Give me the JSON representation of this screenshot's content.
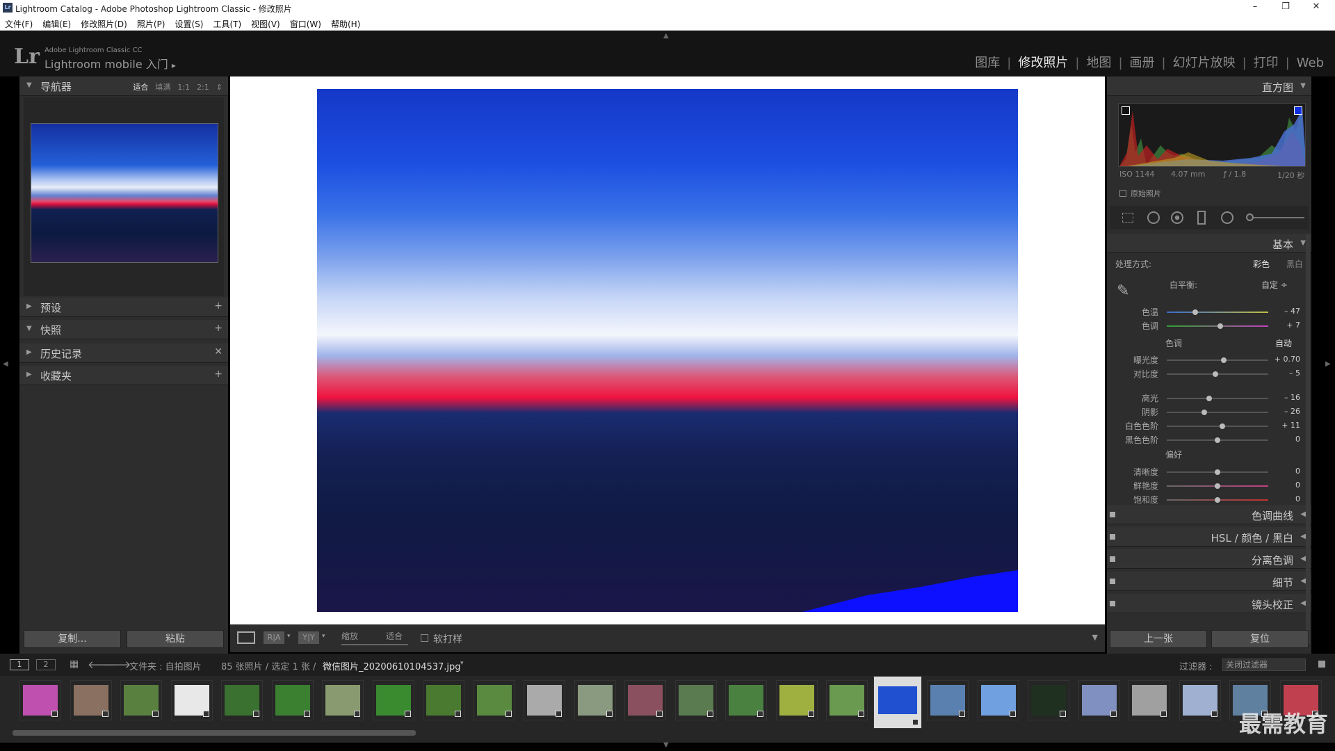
{
  "window": {
    "title": "Lightroom Catalog - Adobe Photoshop Lightroom Classic - 修改照片",
    "app_icon": "Lr",
    "minimize": "–",
    "maximize": "❐",
    "close": "✕"
  },
  "menu": [
    "文件(F)",
    "编辑(E)",
    "修改照片(D)",
    "照片(P)",
    "设置(S)",
    "工具(T)",
    "视图(V)",
    "窗口(W)",
    "帮助(H)"
  ],
  "identity": {
    "logo": "Lr",
    "line1": "Adobe Lightroom Classic CC",
    "line2": "Lightroom mobile 入门",
    "arrow": "▸"
  },
  "modules": [
    "图库",
    "修改照片",
    "地图",
    "画册",
    "幻灯片放映",
    "打印",
    "Web"
  ],
  "active_module": "修改照片",
  "left_panel": {
    "navigator": {
      "title": "导航器",
      "options": [
        "适合",
        "填满",
        "1:1",
        "2:1"
      ],
      "selected": "适合",
      "spin": "⇕"
    },
    "sections": [
      {
        "title": "预设",
        "action": "+"
      },
      {
        "title": "快照",
        "action": "+"
      },
      {
        "title": "历史记录",
        "action": "✕"
      },
      {
        "title": "收藏夹",
        "action": "+"
      }
    ],
    "copy_button": "复制...",
    "paste_button": "粘贴"
  },
  "toolbar": {
    "zoom_label": "缩放",
    "zoom_value": "适合",
    "softproof": "软打样",
    "ry": "R|A",
    "yy": "Y|Y"
  },
  "right_panel": {
    "histogram": {
      "title": "直方图",
      "iso": "ISO 1144",
      "focal": "4.07 mm",
      "aperture": "ƒ / 1.8",
      "shutter": "1/20 秒",
      "original": "原始照片"
    },
    "basic": {
      "title": "基本",
      "treatment_label": "处理方式:",
      "treatment_color": "彩色",
      "treatment_bw": "黑白",
      "wb_label": "白平衡:",
      "wb_value": "自定 ÷",
      "tone_label": "色调",
      "auto": "自动",
      "presence_label": "偏好",
      "sliders": [
        {
          "label": "色温",
          "value": "– 47",
          "pos": 0.28
        },
        {
          "label": "色调",
          "value": "+ 7",
          "pos": 0.53
        },
        {
          "label": "曝光度",
          "value": "+ 0.70",
          "pos": 0.56
        },
        {
          "label": "对比度",
          "value": "– 5",
          "pos": 0.48
        },
        {
          "label": "高光",
          "value": "– 16",
          "pos": 0.42
        },
        {
          "label": "阴影",
          "value": "– 26",
          "pos": 0.37
        },
        {
          "label": "白色色阶",
          "value": "+ 11",
          "pos": 0.55
        },
        {
          "label": "黑色色阶",
          "value": "0",
          "pos": 0.5
        },
        {
          "label": "清晰度",
          "value": "0",
          "pos": 0.5
        },
        {
          "label": "鲜艳度",
          "value": "0",
          "pos": 0.5
        },
        {
          "label": "饱和度",
          "value": "0",
          "pos": 0.5
        }
      ]
    },
    "collapsed": [
      "色调曲线",
      "HSL / 颜色 / 黑白",
      "分离色调",
      "细节",
      "镜头校正"
    ],
    "prev_button": "上一张",
    "reset_button": "复位"
  },
  "filmstrip_bar": {
    "view1": "1",
    "view2": "2",
    "source": "文件夹 : 自拍图片",
    "count": "85 张照片 / 选定 1 张 /",
    "filename": "微信图片_20200610104537.jpg",
    "filter_label": "过滤器 :",
    "filter_value": "关闭过滤器"
  },
  "thumbnails": [
    {
      "color": "#c050b0"
    },
    {
      "color": "#8a7060"
    },
    {
      "color": "#5a8040"
    },
    {
      "color": "#e8e8e8"
    },
    {
      "color": "#3a7030"
    },
    {
      "color": "#3a8030"
    },
    {
      "color": "#8a9a70"
    },
    {
      "color": "#3a8a30"
    },
    {
      "color": "#4a7a30"
    },
    {
      "color": "#5a8a40"
    },
    {
      "color": "#aaaaaa"
    },
    {
      "color": "#8a9a80"
    },
    {
      "color": "#8a5060"
    },
    {
      "color": "#5a7a50"
    },
    {
      "color": "#4a8040"
    },
    {
      "color": "#a0b040"
    },
    {
      "color": "#6a9a50"
    },
    {
      "color": "#2050d0"
    },
    {
      "color": "#5a80b0"
    },
    {
      "color": "#70a0e0"
    },
    {
      "color": "#203020"
    },
    {
      "color": "#8090c0"
    },
    {
      "color": "#a0a0a0"
    },
    {
      "color": "#a0b0d0"
    },
    {
      "color": "#6080a0"
    },
    {
      "color": "#c04050"
    }
  ],
  "watermark": "最需教育"
}
